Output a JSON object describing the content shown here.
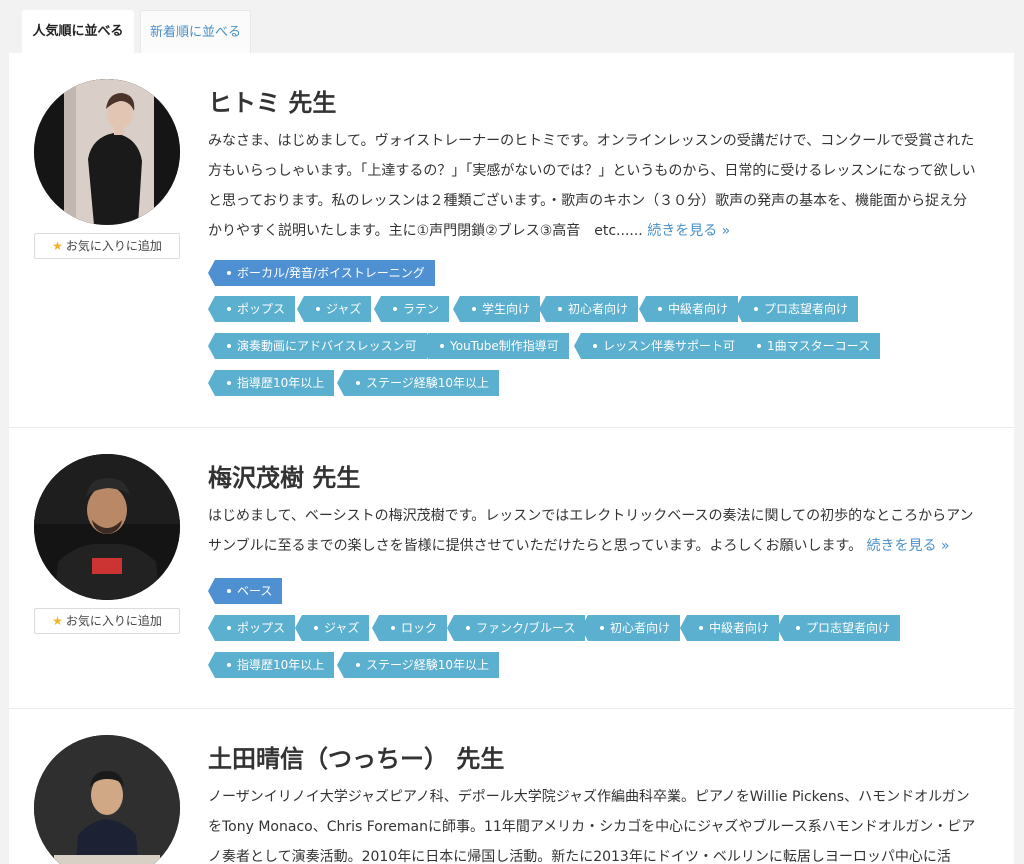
{
  "tabs": {
    "popular_label": "人気順に並べる",
    "newest_label": "新着順に並べる"
  },
  "teachers": [
    {
      "name": "ヒトミ 先生",
      "description": "みなさま、はじめまして。ヴォイストレーナーのヒトミです。オンラインレッスンの受講だけで、コンクールで受賞された方もいらっしゃいます。「上達するの？」「実感がないのでは？」というものから、日常的に受けるレッスンになって欲しいと思っております。私のレッスンは２種類ございます。・歌声のキホン（３０分）歌声の発声の基本を、機能面から捉え分かりやすく説明いたします。主に①声門閉鎖②ブレス③高音　etc......",
      "read_more": "続きを見る »",
      "favorite_label": "お気に入りに追加",
      "category_tag": "ボーカル/発音/ボイストレーニング",
      "tags": [
        "ポップス",
        "ジャズ",
        "ラテン",
        "学生向け",
        "初心者向け",
        "中級者向け",
        "プロ志望者向け",
        "演奏動画にアドバイスレッスン可",
        "YouTube制作指導可",
        "レッスン伴奏サポート可",
        "1曲マスターコース",
        "指導歴10年以上",
        "ステージ経験10年以上"
      ]
    },
    {
      "name": "梅沢茂樹 先生",
      "description": "はじめまして、ベーシストの梅沢茂樹です。レッスンではエレクトリックベースの奏法に関しての初歩的なところからアンサンブルに至るまでの楽しさを皆様に提供させていただけたらと思っています。よろしくお願いします。",
      "read_more": "続きを見る »",
      "favorite_label": "お気に入りに追加",
      "category_tag": "ベース",
      "tags": [
        "ポップス",
        "ジャズ",
        "ロック",
        "ファンク/ブルース",
        "初心者向け",
        "中級者向け",
        "プロ志望者向け",
        "指導歴10年以上",
        "ステージ経験10年以上"
      ]
    },
    {
      "name": "土田晴信（つっちー） 先生",
      "description": "ノーザンイリノイ大学ジャズピアノ科、デポール大学院ジャズ作編曲科卒業。ピアノをWillie Pickens、ハモンドオルガンをTony Monaco、Chris Foremanに師事。11年間アメリカ・シカゴを中心にジャズやブルース系ハモンドオルガン・ピアノ奏者として演奏活動。2010年に日本に帰国し活動。新たに2013年にドイツ・ベルリンに転居しヨーロッパ中心に活動。"
    }
  ],
  "colors": {
    "tag": "#5bafcf",
    "category_tag": "#4f90d3",
    "link": "#4a90c9",
    "star": "#f0b429"
  }
}
